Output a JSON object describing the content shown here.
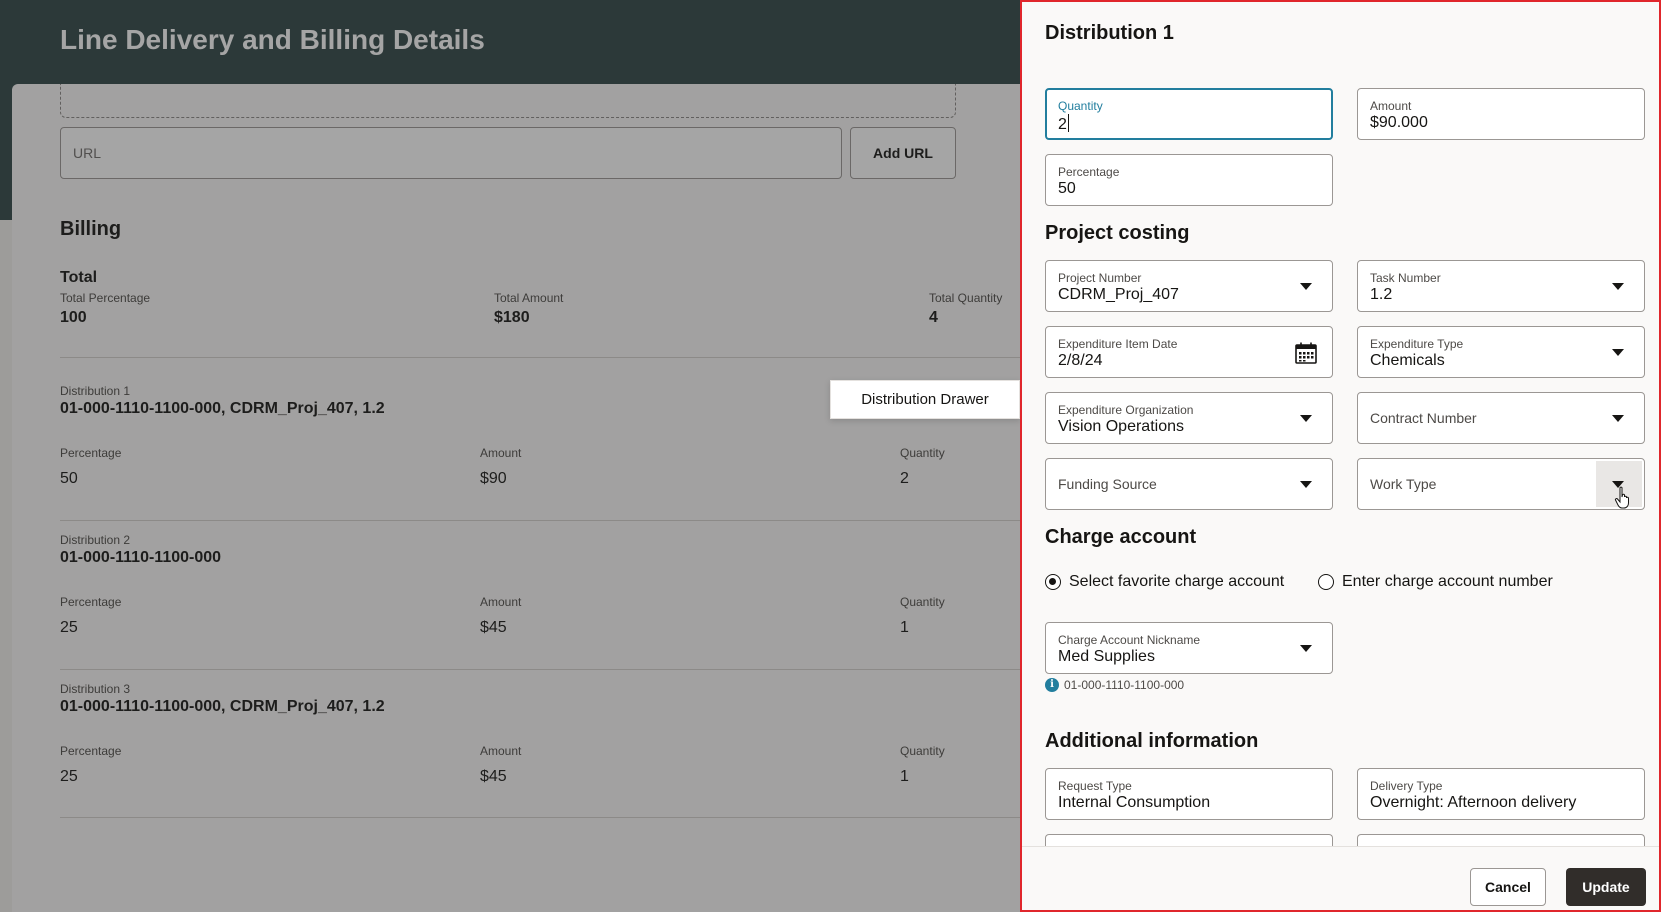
{
  "page": {
    "title": "Line Delivery and Billing Details",
    "url_placeholder": "URL",
    "add_url_label": "Add URL",
    "billing_title": "Billing",
    "total": {
      "title": "Total",
      "percentage_label": "Total Percentage",
      "percentage_value": "100",
      "amount_label": "Total Amount",
      "amount_value": "$180",
      "quantity_label": "Total Quantity",
      "quantity_value": "4"
    },
    "distributions": [
      {
        "name": "Distribution 1",
        "account": "01-000-1110-1100-000, CDRM_Proj_407, 1.2",
        "percentage_label": "Percentage",
        "percentage": "50",
        "amount_label": "Amount",
        "amount": "$90",
        "quantity_label": "Quantity",
        "quantity": "2"
      },
      {
        "name": "Distribution 2",
        "account": "01-000-1110-1100-000",
        "percentage_label": "Percentage",
        "percentage": "25",
        "amount_label": "Amount",
        "amount": "$45",
        "quantity_label": "Quantity",
        "quantity": "1"
      },
      {
        "name": "Distribution 3",
        "account": "01-000-1110-1100-000, CDRM_Proj_407, 1.2",
        "percentage_label": "Percentage",
        "percentage": "25",
        "amount_label": "Amount",
        "amount": "$45",
        "quantity_label": "Quantity",
        "quantity": "1"
      }
    ],
    "tooltip": "Distribution Drawer"
  },
  "drawer": {
    "title": "Distribution 1",
    "quantity": {
      "label": "Quantity",
      "value": "2"
    },
    "amount": {
      "label": "Amount",
      "value": "$90.000"
    },
    "percentage": {
      "label": "Percentage",
      "value": "50"
    },
    "project_costing": {
      "title": "Project costing",
      "project_number": {
        "label": "Project Number",
        "value": "CDRM_Proj_407"
      },
      "task_number": {
        "label": "Task Number",
        "value": "1.2"
      },
      "expenditure_item_date": {
        "label": "Expenditure Item Date",
        "value": "2/8/24"
      },
      "expenditure_type": {
        "label": "Expenditure Type",
        "value": "Chemicals"
      },
      "expenditure_organization": {
        "label": "Expenditure Organization",
        "value": "Vision Operations"
      },
      "contract_number": {
        "placeholder": "Contract Number"
      },
      "funding_source": {
        "placeholder": "Funding Source"
      },
      "work_type": {
        "placeholder": "Work Type"
      }
    },
    "charge_account": {
      "title": "Charge account",
      "option_favorite": "Select favorite charge account",
      "option_enter": "Enter charge account number",
      "nickname": {
        "label": "Charge Account Nickname",
        "value": "Med Supplies"
      },
      "account_info": "01-000-1110-1100-000"
    },
    "additional_information": {
      "title": "Additional information",
      "request_type": {
        "label": "Request Type",
        "value": "Internal Consumption"
      },
      "delivery_type": {
        "label": "Delivery Type",
        "value": "Overnight: Afternoon delivery"
      }
    },
    "cancel_label": "Cancel",
    "update_label": "Update"
  },
  "colors": {
    "hero": "#2f4646",
    "focus": "#227e9e",
    "highlight_border": "#e0262c",
    "primary_button": "#312d2a"
  }
}
